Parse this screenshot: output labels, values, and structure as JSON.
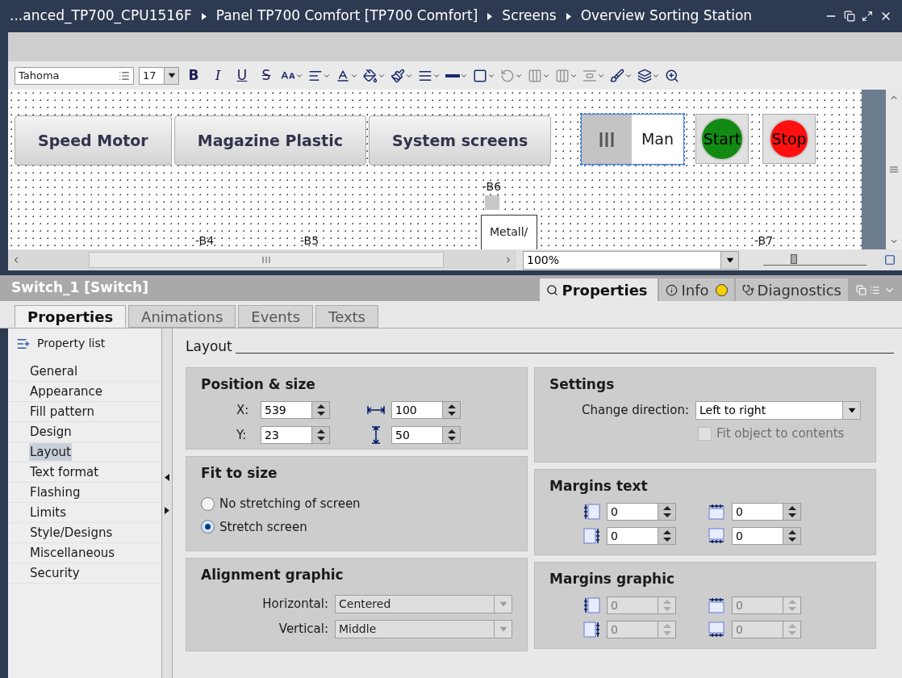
{
  "title_bar": {
    "breadcrumbs": [
      "...anced_TP700_CPU1516F",
      "Panel TP700 Comfort [TP700 Comfort]",
      "Screens",
      "Overview Sorting Station"
    ]
  },
  "toolbar": {
    "font": "Tahoma",
    "font_size": "17",
    "format_buttons": [
      "B",
      "I",
      "U",
      "S"
    ]
  },
  "canvas": {
    "buttons": [
      "Speed Motor",
      "Magazine Plastic",
      "System screens"
    ],
    "switch": {
      "label": "Man",
      "selected": true
    },
    "start_button": "Start",
    "stop_button": "Stop",
    "tags": [
      {
        "label": "-B6",
        "kind": "sensor"
      },
      {
        "label": "-B4",
        "kind": "plain"
      },
      {
        "label": "-B5",
        "kind": "plain"
      },
      {
        "label": "-B7",
        "kind": "plain"
      }
    ],
    "sensor_box": "Metall/"
  },
  "zoom": {
    "value": "100%",
    "level": 0.3
  },
  "inspector": {
    "title": "Switch_1 [Switch]",
    "panel_tabs": [
      {
        "label": "Properties",
        "selected": true,
        "kind": "properties"
      },
      {
        "label": "Info",
        "selected": false,
        "kind": "info"
      },
      {
        "label": "Diagnostics",
        "selected": false,
        "kind": "diagnostics"
      }
    ],
    "tabs": [
      {
        "label": "Properties",
        "selected": true
      },
      {
        "label": "Animations",
        "selected": false
      },
      {
        "label": "Events",
        "selected": false
      },
      {
        "label": "Texts",
        "selected": false
      }
    ]
  },
  "sidebar": {
    "header": "Property list",
    "items": [
      {
        "label": "General",
        "selected": false
      },
      {
        "label": "Appearance",
        "selected": false
      },
      {
        "label": "Fill pattern",
        "selected": false
      },
      {
        "label": "Design",
        "selected": false
      },
      {
        "label": "Layout",
        "selected": true
      },
      {
        "label": "Text format",
        "selected": false
      },
      {
        "label": "Flashing",
        "selected": false
      },
      {
        "label": "Limits",
        "selected": false
      },
      {
        "label": "Style/Designs",
        "selected": false
      },
      {
        "label": "Miscellaneous",
        "selected": false
      },
      {
        "label": "Security",
        "selected": false
      }
    ]
  },
  "section_title": "Layout",
  "position_size": {
    "title": "Position & size",
    "fields": [
      {
        "kind": "x",
        "label": "X:",
        "value": "539"
      },
      {
        "kind": "width",
        "value": "100"
      },
      {
        "kind": "y",
        "label": "Y:",
        "value": "23"
      },
      {
        "kind": "height",
        "value": "50"
      }
    ]
  },
  "fit_to_size": {
    "title": "Fit to size",
    "options": [
      {
        "label": "No stretching of screen",
        "selected": false
      },
      {
        "label": "Stretch screen",
        "selected": true
      }
    ]
  },
  "alignment_graphic": {
    "title": "Alignment graphic",
    "disabled": true,
    "fields": [
      {
        "label": "Horizontal:",
        "value": "Centered"
      },
      {
        "label": "Vertical:",
        "value": "Middle"
      }
    ]
  },
  "settings": {
    "title": "Settings",
    "change_direction": {
      "label": "Change direction:",
      "value": "Left to right"
    },
    "fit_object": {
      "label": "Fit object to contents",
      "checked": false,
      "disabled": true
    }
  },
  "margins_text": {
    "title": "Margins text",
    "disabled": false,
    "fields": [
      {
        "kind": "left",
        "value": "0"
      },
      {
        "kind": "top",
        "value": "0"
      },
      {
        "kind": "right",
        "value": "0"
      },
      {
        "kind": "bottom",
        "value": "0"
      }
    ]
  },
  "margins_graphic": {
    "title": "Margins graphic",
    "disabled": true,
    "fields": [
      {
        "kind": "left",
        "value": "0"
      },
      {
        "kind": "top",
        "value": "0"
      },
      {
        "kind": "right",
        "value": "0"
      },
      {
        "kind": "bottom",
        "value": "0"
      }
    ]
  }
}
